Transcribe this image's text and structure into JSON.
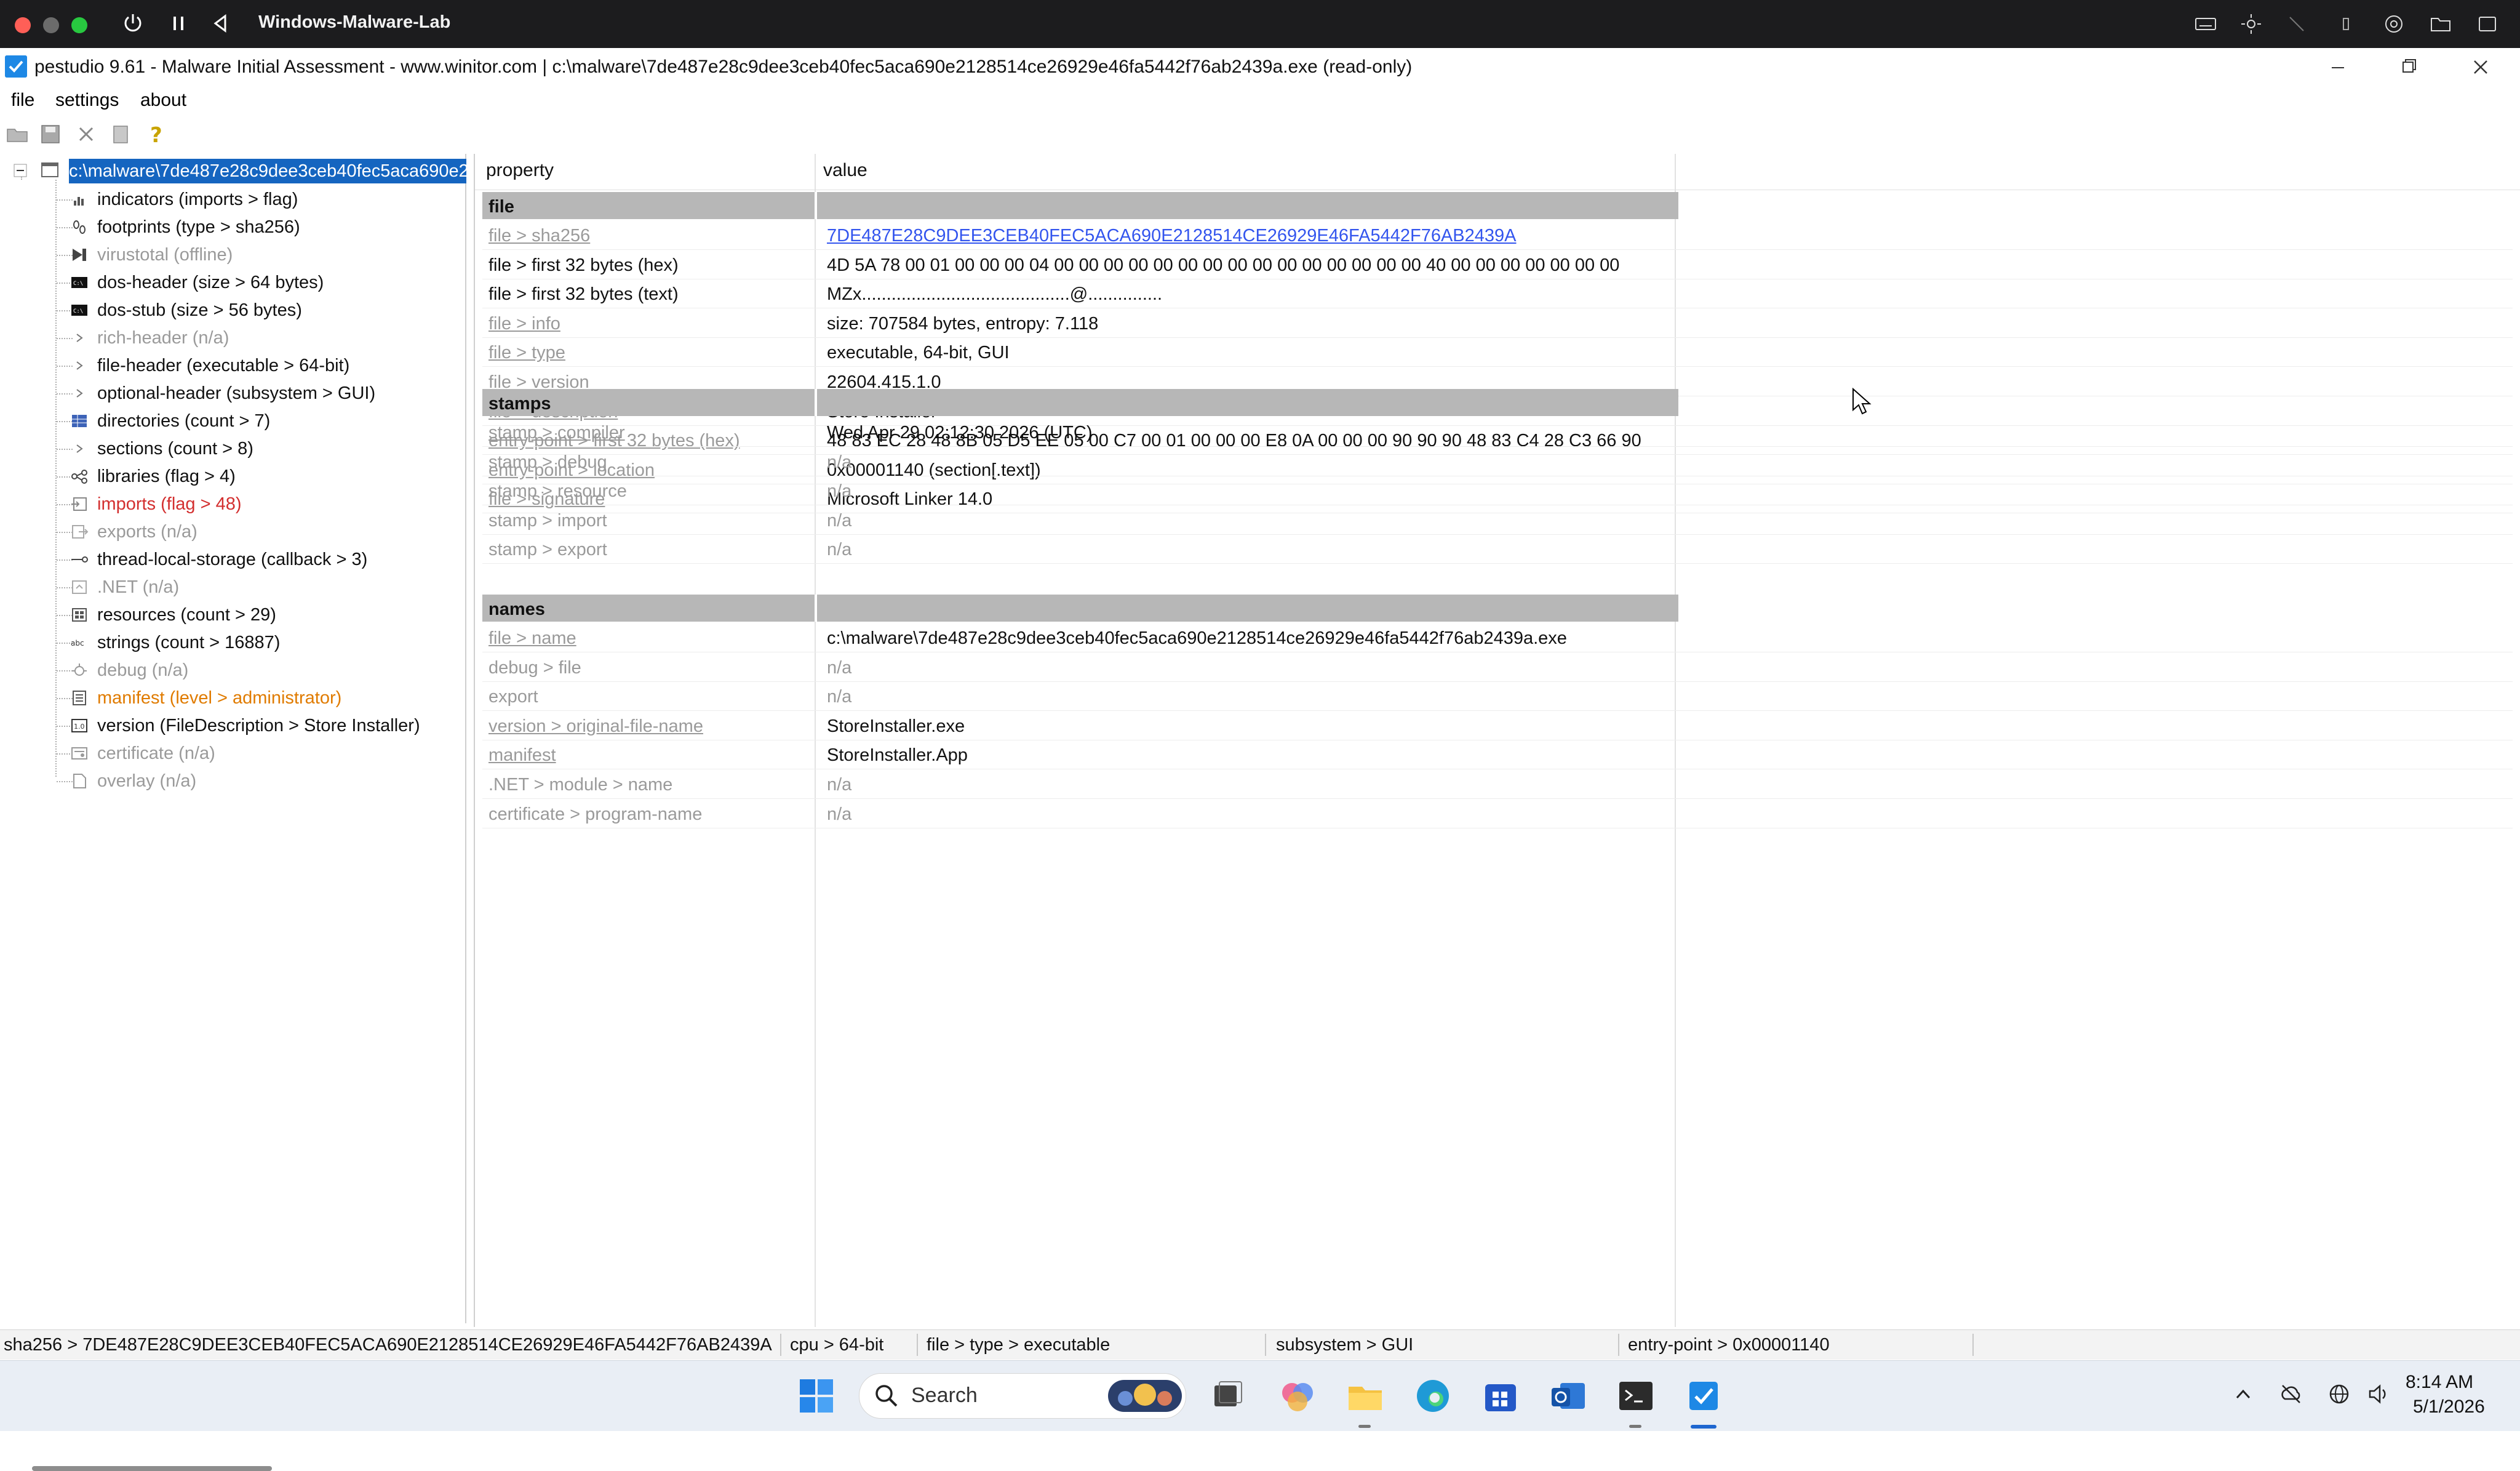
{
  "vm": {
    "title": "Windows-Malware-Lab",
    "colors": {
      "close": "#ff5f57",
      "minimize": "#febc2e",
      "maximize": "#28c840"
    }
  },
  "app": {
    "title": "pestudio 9.61 - Malware Initial Assessment - www.winitor.com | c:\\malware\\7de487e28c9dee3ceb40fec5aca690e2128514ce26929e46fa5442f76ab2439a.exe (read-only)"
  },
  "menu": {
    "file": "file",
    "settings": "settings",
    "about": "about"
  },
  "tree": {
    "root": "c:\\malware\\7de487e28c9dee3ceb40fec5aca690e2",
    "items": [
      {
        "label": "indicators (imports > flag)",
        "style": "black",
        "icon": "bars-icon"
      },
      {
        "label": "footprints (type > sha256)",
        "style": "black",
        "icon": "footprints-icon"
      },
      {
        "label": "virustotal (offline)",
        "style": "grey",
        "icon": "virustotal-icon"
      },
      {
        "label": "dos-header (size > 64 bytes)",
        "style": "black",
        "icon": "console-icon"
      },
      {
        "label": "dos-stub (size > 56 bytes)",
        "style": "black",
        "icon": "console-icon"
      },
      {
        "label": "rich-header (n/a)",
        "style": "grey",
        "icon": "expand-icon"
      },
      {
        "label": "file-header (executable > 64-bit)",
        "style": "black",
        "icon": "expand-icon"
      },
      {
        "label": "optional-header (subsystem > GUI)",
        "style": "black",
        "icon": "expand-icon"
      },
      {
        "label": "directories (count > 7)",
        "style": "black",
        "icon": "grid-icon"
      },
      {
        "label": "sections (count > 8)",
        "style": "black",
        "icon": "expand-icon"
      },
      {
        "label": "libraries (flag > 4)",
        "style": "black",
        "icon": "link-icon"
      },
      {
        "label": "imports (flag > 48)",
        "style": "red",
        "icon": "imports-icon"
      },
      {
        "label": "exports (n/a)",
        "style": "grey",
        "icon": "exports-icon"
      },
      {
        "label": "thread-local-storage (callback > 3)",
        "style": "black",
        "icon": "thread-icon"
      },
      {
        "label": ".NET (n/a)",
        "style": "grey",
        "icon": "dotnet-icon"
      },
      {
        "label": "resources (count > 29)",
        "style": "black",
        "icon": "resources-icon"
      },
      {
        "label": "strings (count > 16887)",
        "style": "black",
        "icon": "abc-icon"
      },
      {
        "label": "debug (n/a)",
        "style": "grey",
        "icon": "bug-icon"
      },
      {
        "label": "manifest (level > administrator)",
        "style": "orange",
        "icon": "manifest-icon"
      },
      {
        "label": "version (FileDescription > Store Installer)",
        "style": "black",
        "icon": "version-icon"
      },
      {
        "label": "certificate (n/a)",
        "style": "grey",
        "icon": "certificate-icon"
      },
      {
        "label": "overlay (n/a)",
        "style": "grey",
        "icon": "overlay-icon"
      }
    ]
  },
  "table": {
    "headers": {
      "property": "property",
      "value": "value"
    },
    "sections": [
      {
        "name": "file",
        "rows": [
          {
            "prop": "file > sha256",
            "value": "7DE487E28C9DEE3CEB40FEC5ACA690E2128514CE26929E46FA5442F76AB2439A",
            "pstyle": "grey-u",
            "vstyle": "link"
          },
          {
            "prop": "file > first 32 bytes (hex)",
            "value": "4D 5A 78 00 01 00 00 00 04 00 00 00 00 00 00 00 00 00 00 00 00 00 00 00 40 00 00 00 00 00 00 00",
            "pstyle": "black",
            "vstyle": ""
          },
          {
            "prop": "file > first 32 bytes (text)",
            "value": "MZx..........................................@...............",
            "pstyle": "black",
            "vstyle": ""
          },
          {
            "prop": "file > info",
            "value": "size: 707584 bytes, entropy: 7.118",
            "pstyle": "grey-u",
            "vstyle": ""
          },
          {
            "prop": "file > type",
            "value": "executable, 64-bit, GUI",
            "pstyle": "grey-u",
            "vstyle": ""
          },
          {
            "prop": "file > version",
            "value": "22604.415.1.0",
            "pstyle": "grey-u",
            "vstyle": ""
          },
          {
            "prop": "file > description",
            "value": "Store Installer",
            "pstyle": "grey-u",
            "vstyle": ""
          },
          {
            "prop": "entry-point > first 32 bytes (hex)",
            "value": "48 83 EC 28 48 8B 05 D5 EE 05 00 C7 00 01 00 00 00 E8 0A 00 00 00 90 90 90 48 83 C4 28 C3 66 90",
            "pstyle": "grey-u",
            "vstyle": ""
          },
          {
            "prop": "entry-point > location",
            "value": "0x00001140 (section[.text])",
            "pstyle": "grey-u",
            "vstyle": ""
          },
          {
            "prop": "file > signature",
            "value": "Microsoft Linker 14.0",
            "pstyle": "grey-u",
            "vstyle": ""
          }
        ]
      },
      {
        "name": "stamps",
        "rows": [
          {
            "prop": "stamp > compiler",
            "value": "Wed Apr 29 02:12:30 2026 (UTC)",
            "pstyle": "grey-u",
            "vstyle": ""
          },
          {
            "prop": "stamp > debug",
            "value": "n/a",
            "pstyle": "grey",
            "vstyle": "grey"
          },
          {
            "prop": "stamp > resource",
            "value": "n/a",
            "pstyle": "grey",
            "vstyle": "grey"
          },
          {
            "prop": "stamp > import",
            "value": "n/a",
            "pstyle": "grey",
            "vstyle": "grey"
          },
          {
            "prop": "stamp > export",
            "value": "n/a",
            "pstyle": "grey",
            "vstyle": "grey"
          }
        ]
      },
      {
        "name": "names",
        "rows": [
          {
            "prop": "file > name",
            "value": "c:\\malware\\7de487e28c9dee3ceb40fec5aca690e2128514ce26929e46fa5442f76ab2439a.exe",
            "pstyle": "grey-u",
            "vstyle": ""
          },
          {
            "prop": "debug > file",
            "value": "n/a",
            "pstyle": "grey",
            "vstyle": "grey"
          },
          {
            "prop": "export",
            "value": "n/a",
            "pstyle": "grey",
            "vstyle": "grey"
          },
          {
            "prop": "version > original-file-name",
            "value": "StoreInstaller.exe",
            "pstyle": "grey-u",
            "vstyle": ""
          },
          {
            "prop": "manifest",
            "value": "StoreInstaller.App",
            "pstyle": "grey-u",
            "vstyle": ""
          },
          {
            "prop": ".NET > module > name",
            "value": "n/a",
            "pstyle": "grey",
            "vstyle": "grey"
          },
          {
            "prop": "certificate > program-name",
            "value": "n/a",
            "pstyle": "grey",
            "vstyle": "grey"
          }
        ]
      }
    ]
  },
  "status": {
    "sha256": "sha256 > 7DE487E28C9DEE3CEB40FEC5ACA690E2128514CE26929E46FA5442F76AB2439A",
    "cpu": "cpu > 64-bit",
    "type": "file > type > executable",
    "subsystem": "subsystem > GUI",
    "entry": "entry-point > 0x00001140"
  },
  "taskbar": {
    "search": "Search",
    "time": "8:14 AM",
    "date": "5/1/2026"
  }
}
